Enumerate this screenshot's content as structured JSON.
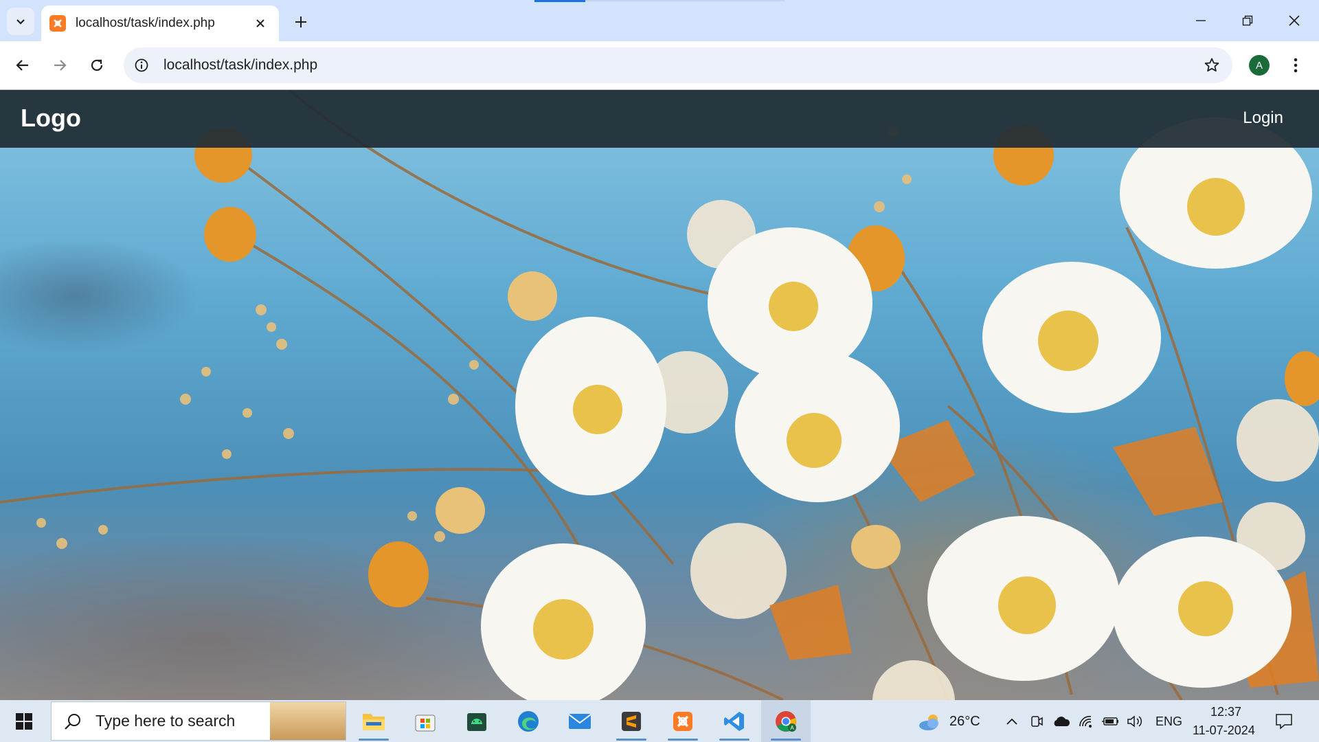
{
  "browser": {
    "tab": {
      "title": "localhost/task/index.php"
    },
    "omnibox": {
      "url": "localhost/task/index.php"
    },
    "profile_initial": "A"
  },
  "page": {
    "nav": {
      "logo": "Logo",
      "login": "Login"
    }
  },
  "taskbar": {
    "search_placeholder": "Type here to search",
    "apps": [
      "file-explorer",
      "microsoft-store",
      "android-studio",
      "edge",
      "mail",
      "sublime-text",
      "xampp",
      "vscode",
      "chrome"
    ],
    "weather": {
      "temp": "26°C"
    },
    "language": "ENG",
    "time": "12:37",
    "date": "11-07-2024"
  },
  "colors": {
    "tabstrip": "#d3e3fd",
    "nav_bg": "#202c34",
    "taskbar": "#dde8f3",
    "xampp": "#fb7a24"
  }
}
